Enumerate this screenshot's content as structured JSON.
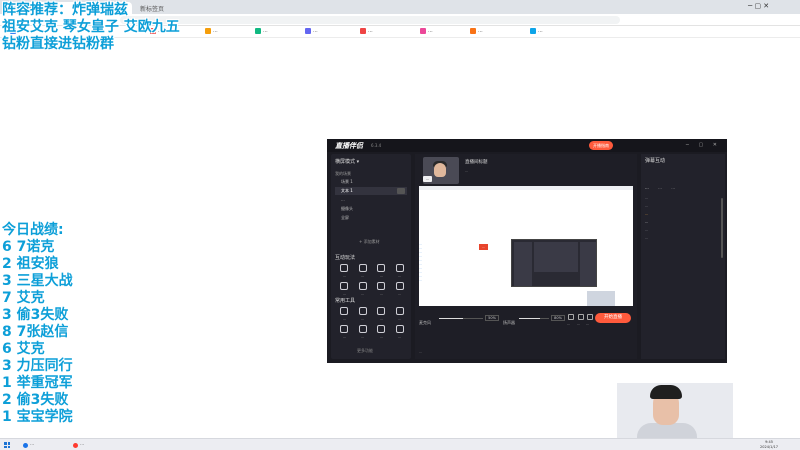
{
  "browser": {
    "tabs": [
      {
        "label": "直播 ..."
      },
      {
        "label": "新标签页"
      }
    ],
    "window_controls": "─  ▢  ✕",
    "bookmarks": [
      {
        "label": "...",
        "color": "#3b82f6"
      },
      {
        "label": "...",
        "color": "#ef4444"
      },
      {
        "label": "...",
        "color": "#f59e0b"
      },
      {
        "label": "...",
        "color": "#10b981"
      },
      {
        "label": "...",
        "color": "#6366f1"
      },
      {
        "label": "...",
        "color": "#ef4444"
      },
      {
        "label": "...",
        "color": "#ec4899"
      },
      {
        "label": "...",
        "color": "#f97316"
      },
      {
        "label": "...",
        "color": "#0ea5e9"
      }
    ]
  },
  "overlay_top": [
    "阵容推荐：炸弹瑞兹",
    "祖安艾克  琴女皇子  艾欧九五",
    "钻粉直接进钻粉群"
  ],
  "overlay_bottom": [
    "今日战绩:",
    "6 7诺克",
    "2 祖安狼",
    "3 三星大战",
    "7 艾克",
    "3 偷3失败",
    "8 7张赵信",
    "6 艾克",
    "3 力压同行",
    "1 举重冠军",
    "2 偷3失败",
    "1 宝宝学院"
  ],
  "app": {
    "logo": "直播伴侣",
    "version": "6.3.4",
    "open_label": "开播指南",
    "window_buttons": "─ ▢ ✕",
    "mode": "横屏模式 ▾",
    "scene_header": "我的场景",
    "scenes": [
      {
        "label": "场景 1"
      },
      {
        "label": "文本 1"
      },
      {
        "label": "..."
      },
      {
        "label": "摄像头"
      },
      {
        "label": "全屏"
      }
    ],
    "add_source": "+ 添加素材",
    "interaction_title": "互动玩法",
    "interaction_tools": [
      "...",
      "...",
      "...",
      "...",
      "...",
      "...",
      "...",
      "..."
    ],
    "common_title": "常用工具",
    "common_tools": [
      "...",
      "...",
      "...",
      "...",
      "...",
      "...",
      "...",
      "..."
    ],
    "more": "更多功能",
    "room_title": "直播间标题",
    "room_sub": "...",
    "tip": "...",
    "canvas_list": [
      "...",
      "...",
      "...",
      "...",
      "...",
      "...",
      "...",
      "...",
      "...",
      "..."
    ],
    "canvas_toast": "...",
    "mic_label": "麦克风",
    "mic_pct": "50%",
    "speaker_label": "扬声器",
    "speaker_pct": "80%",
    "mic_level": 0.55,
    "speaker_level": 0.7,
    "ctl_labels": [
      "...",
      "...",
      "..."
    ],
    "start_label": "开始直播",
    "status": "...",
    "right_header": "弹幕互动",
    "right_tabs": [
      {
        "label": "...",
        "active": true
      },
      {
        "label": "...",
        "active": false
      },
      {
        "label": "...",
        "active": false
      }
    ],
    "chat": [
      "...",
      "...",
      "...",
      "...",
      "...",
      "..."
    ]
  },
  "taskbar": {
    "items": [
      {
        "label": "...",
        "color": "#1a73e8"
      },
      {
        "label": "...",
        "color": "#ff3b30"
      }
    ],
    "time": "9:45",
    "date": "2024/1/17"
  }
}
